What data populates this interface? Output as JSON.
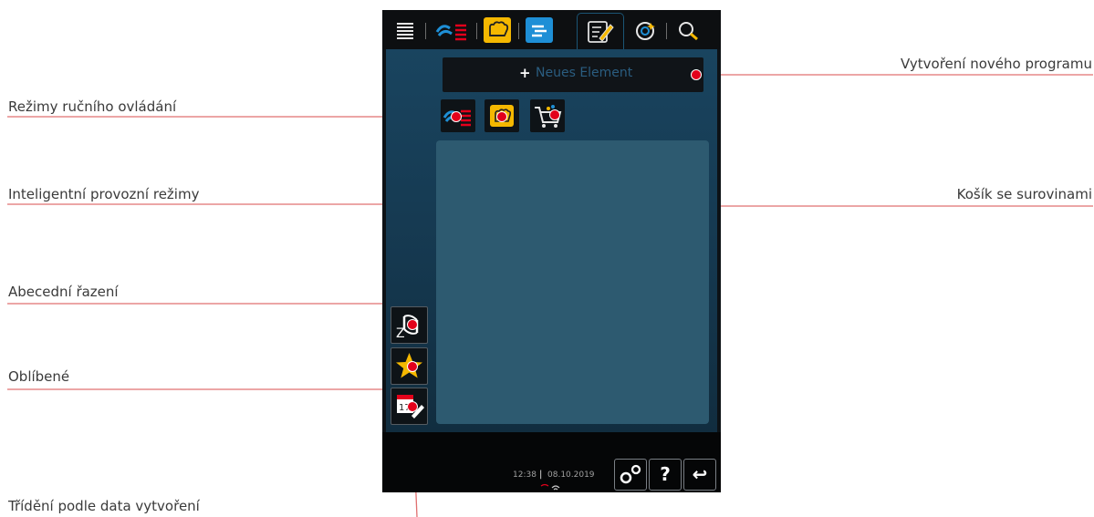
{
  "annotations": {
    "manual_modes": "Režimy ručního ovládání",
    "intelligent_modes": "Inteligentní provozní režimy",
    "alphabetical_sort": "Abecední řazení",
    "favorites": "Oblíbené",
    "sort_by_date": "Třídění podle data vytvoření",
    "new_program": "Vytvoření nového programu",
    "basket": "Košík se surovinami"
  },
  "screen": {
    "new_button": {
      "plus": "+",
      "label": "Neues Element"
    },
    "sort_alpha_glyph": "Z",
    "calendar_day": "17",
    "status": {
      "time": "12:38",
      "separator": "|",
      "date": "08.10.2019"
    },
    "help_glyph": "?",
    "back_glyph": "↩"
  },
  "colors": {
    "accent_red": "#e3001b",
    "tab_yellow": "#f5b800",
    "tab_blue": "#1e8fd6",
    "leader_line": "#e07070",
    "screen_panel": "#19445f",
    "list_area": "#2d5a70"
  },
  "icons": [
    "menu-icon",
    "manual-modes-icon",
    "intelligent-modes-icon",
    "production-icon",
    "programming-icon",
    "ican-icon",
    "search-icon",
    "basket-icon",
    "sort-alpha-icon",
    "star-icon",
    "calendar-edit-icon",
    "settings-icon",
    "help-icon",
    "back-icon",
    "wifi-icon"
  ]
}
